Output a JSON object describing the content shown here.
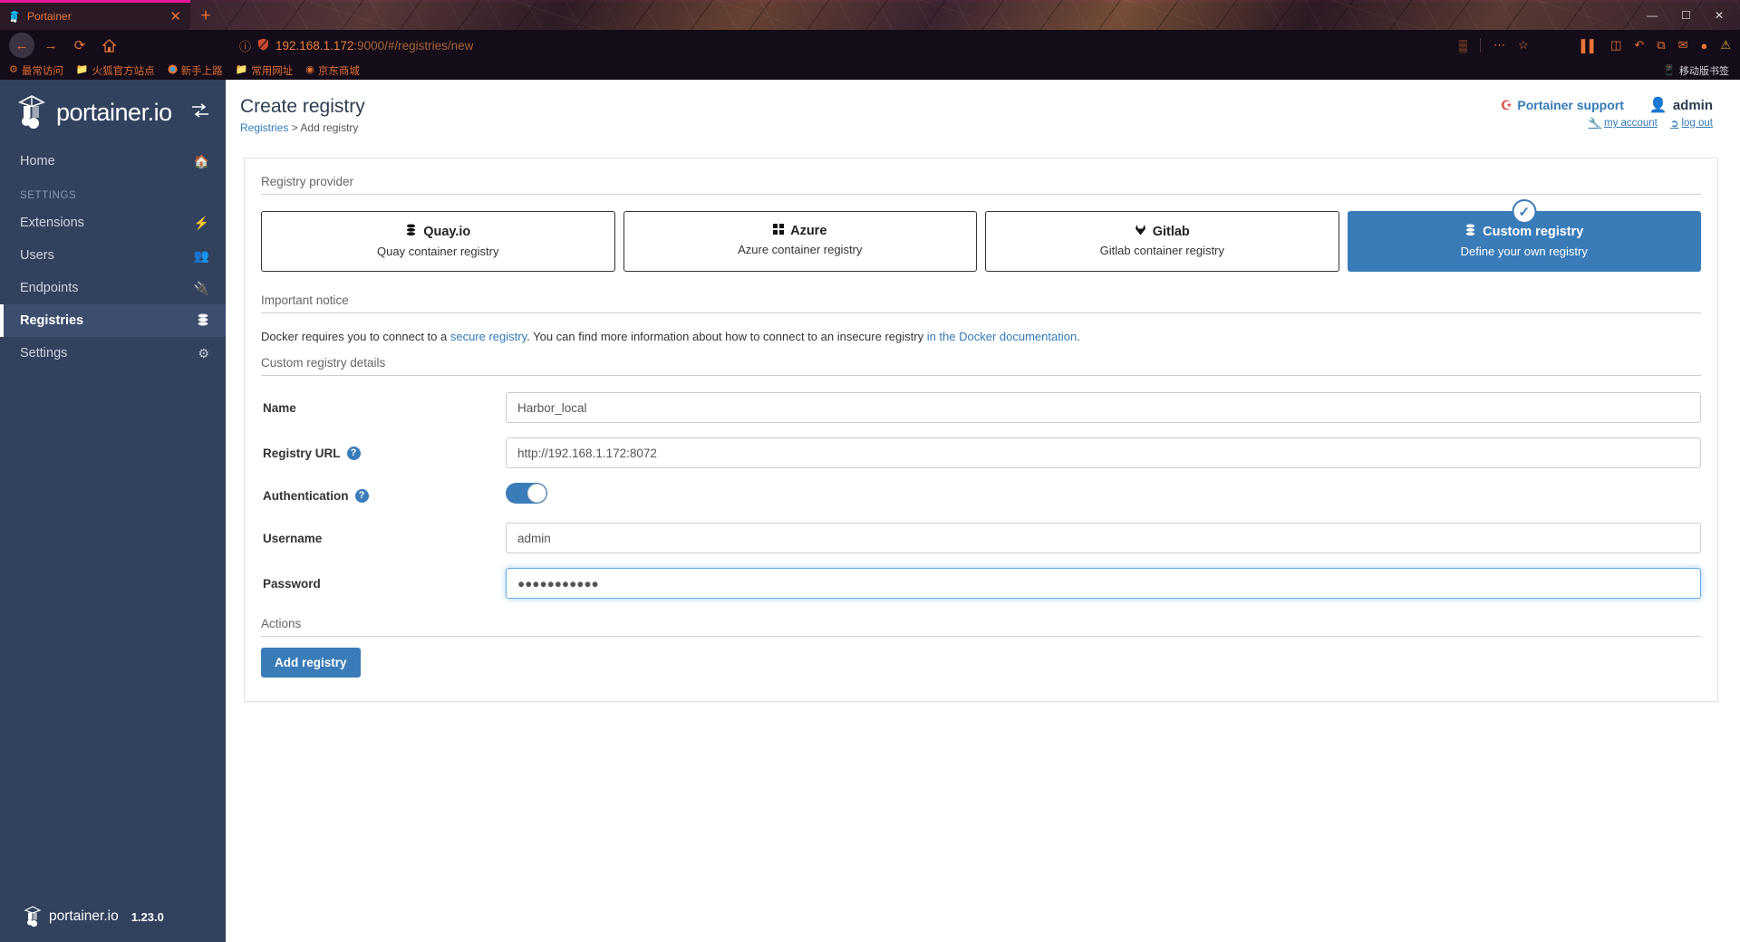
{
  "browser": {
    "tab": {
      "title": "Portainer",
      "favicon": "portainer-icon",
      "close": "✕"
    },
    "new_tab": "+",
    "window_controls": {
      "minimize": "—",
      "maximize": "☐",
      "close": "✕"
    },
    "nav": {
      "back": "←",
      "forward": "→",
      "reload": "⟳",
      "home": "⌂"
    },
    "url": {
      "info_icon": "ⓘ",
      "shield_icon": "shield-icon",
      "host": "192.168.1.172",
      "rest": ":9000/#/registries/new",
      "full": "192.168.1.172:9000/#/registries/new"
    },
    "toolbar_right": {
      "qr": "▒",
      "menu_dots": "⋯",
      "star": "☆",
      "library": "▌▌",
      "sidebar": "◫",
      "undo": "↶",
      "puzzle": "⧉",
      "chat": "✉",
      "account": "●",
      "alert": "⚠"
    },
    "bookmarks": [
      {
        "label": "最常访问",
        "icon": "gear-icon"
      },
      {
        "label": "火狐官方站点",
        "icon": "folder-icon"
      },
      {
        "label": "新手上路",
        "icon": "firefox-icon"
      },
      {
        "label": "常用网址",
        "icon": "folder-icon"
      },
      {
        "label": "京东商城",
        "icon": "jd-icon"
      }
    ],
    "bookmarks_right": {
      "label": "移动版书签",
      "icon": "mobile-icon"
    }
  },
  "sidebar": {
    "brand": "portainer.io",
    "toggle_icon": "collapse-icon",
    "items": [
      {
        "label": "Home",
        "icon": "home-icon",
        "active": false
      },
      {
        "label": "Extensions",
        "icon": "bolt-icon",
        "active": false
      },
      {
        "label": "Users",
        "icon": "users-icon",
        "active": false
      },
      {
        "label": "Endpoints",
        "icon": "plug-icon",
        "active": false
      },
      {
        "label": "Registries",
        "icon": "database-icon",
        "active": true
      },
      {
        "label": "Settings",
        "icon": "gears-icon",
        "active": false
      }
    ],
    "section_header": "SETTINGS",
    "footer": {
      "brand": "portainer.io",
      "version": "1.23.0"
    }
  },
  "header": {
    "title": "Create registry",
    "breadcrumb": {
      "parent": "Registries",
      "separator": ">",
      "current": "Add registry"
    },
    "support_label": "Portainer support",
    "support_icon": "lifering-icon",
    "user_name": "admin",
    "user_icon": "user-circle-icon",
    "my_account": "my account",
    "my_account_icon": "wrench-icon",
    "log_out": "log out",
    "log_out_icon": "sign-out-icon"
  },
  "main": {
    "provider_section_title": "Registry provider",
    "providers": [
      {
        "name": "Quay.io",
        "description": "Quay container registry",
        "icon": "database-icon",
        "selected": false
      },
      {
        "name": "Azure",
        "description": "Azure container registry",
        "icon": "azure-icon",
        "selected": false
      },
      {
        "name": "Gitlab",
        "description": "Gitlab container registry",
        "icon": "gitlab-icon",
        "selected": false
      },
      {
        "name": "Custom registry",
        "description": "Define your own registry",
        "icon": "database-icon",
        "selected": true
      }
    ],
    "selected_check_icon": "check-icon",
    "notice_section_title": "Important notice",
    "notice": {
      "part1": "Docker requires you to connect to a ",
      "link1": "secure registry",
      "part2": ". You can find more information about how to connect to an insecure registry ",
      "link2": "in the Docker documentation",
      "part3": "."
    },
    "details_section_title": "Custom registry details",
    "fields": {
      "name": {
        "label": "Name",
        "value": "Harbor_local"
      },
      "registry_url": {
        "label": "Registry URL",
        "value": "http://192.168.1.172:8072",
        "help_icon": "question-icon"
      },
      "authentication": {
        "label": "Authentication",
        "enabled": true,
        "help_icon": "question-icon"
      },
      "username": {
        "label": "Username",
        "value": "admin"
      },
      "password": {
        "label": "Password",
        "value": "●●●●●●●●●●●"
      }
    },
    "actions_section_title": "Actions",
    "submit_label": "Add registry"
  }
}
